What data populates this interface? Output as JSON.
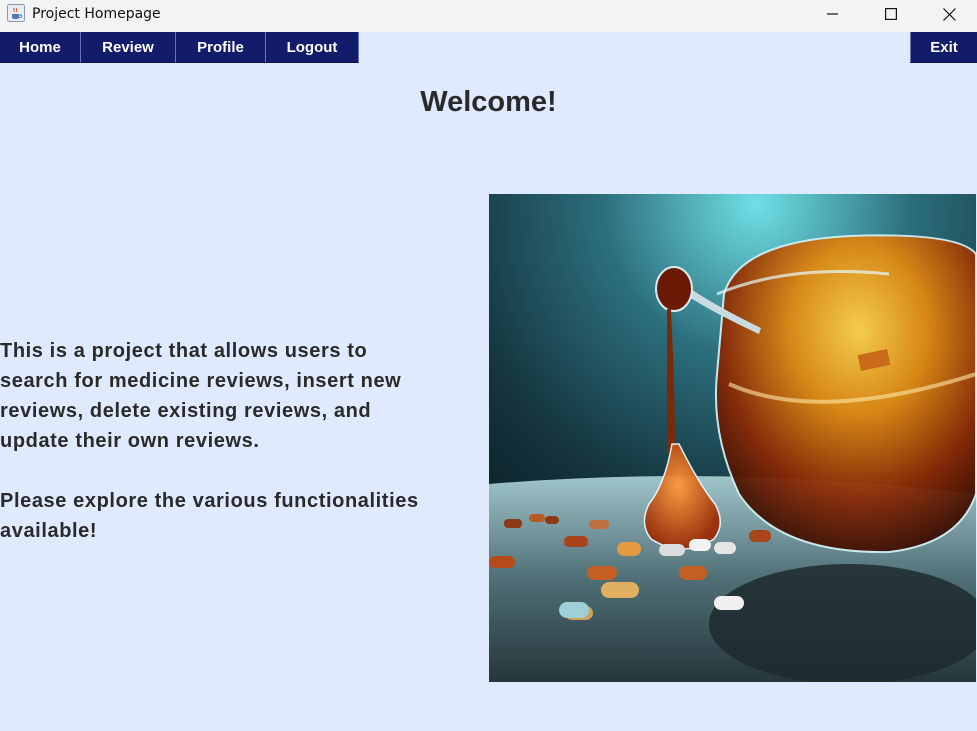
{
  "window": {
    "title": "Project Homepage",
    "icons": {
      "app": "java-cup-icon",
      "minimize": "minimize-icon",
      "maximize": "maximize-icon",
      "close": "close-icon"
    }
  },
  "menu": {
    "home": "Home",
    "review": "Review",
    "profile": "Profile",
    "logout": "Logout",
    "exit": "Exit"
  },
  "main": {
    "heading": "Welcome!",
    "description_line1": "This is a project that allows users to",
    "description_line2": "search for medicine reviews, insert new",
    "description_line3": "reviews, delete existing reviews, and",
    "description_line4": "update their own reviews.",
    "explore_line1": "Please explore the various functionalities",
    "explore_line2": "available!"
  },
  "colors": {
    "background": "#dfeaff",
    "menu_button": "#131c6b",
    "text": "#2a2a2a"
  }
}
